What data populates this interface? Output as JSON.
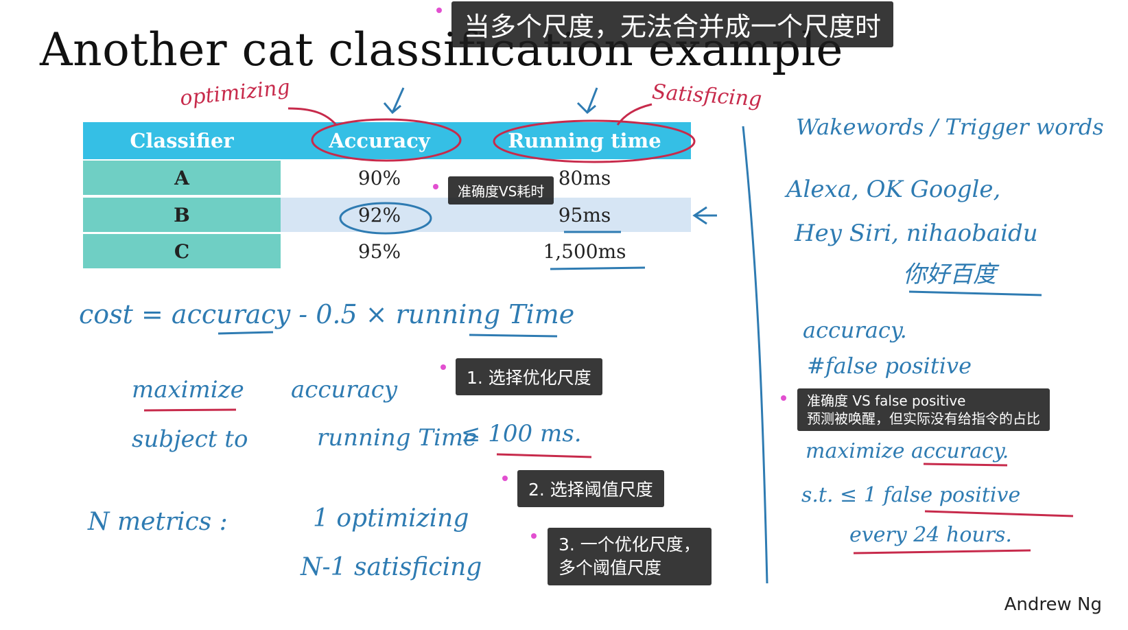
{
  "slide": {
    "title": "Another cat classification example",
    "credit": "Andrew Ng"
  },
  "table": {
    "headers": [
      "Classifier",
      "Accuracy",
      "Running time"
    ],
    "rows": [
      {
        "name": "A",
        "accuracy": "90%",
        "running_time": "80ms"
      },
      {
        "name": "B",
        "accuracy": "92%",
        "running_time": "95ms"
      },
      {
        "name": "C",
        "accuracy": "95%",
        "running_time": "1,500ms"
      }
    ]
  },
  "annotations": {
    "optimizing_label": "optimizing",
    "satisficing_label": "Satisficing",
    "cost_formula": "cost = accuracy - 0.5 × running Time",
    "maximize": "maximize",
    "maximize_target": "accuracy",
    "subject_to": "subject to",
    "constraint": "running Time",
    "constraint_bound": "≤ 100 ms.",
    "n_metrics": "N metrics :",
    "one_optimizing": "1 optimizing",
    "n_minus_one": "N-1 satisficing"
  },
  "right_notes": {
    "wakewords": "Wakewords / Trigger words",
    "examples_1": "Alexa, OK Google,",
    "examples_2": "Hey Siri, nihaobaidu",
    "examples_3": "你好百度",
    "accuracy": "accuracy.",
    "false_positive": "#false positive",
    "maximize_accuracy": "maximize accuracy.",
    "st": "s.t. ≤ 1 false positive",
    "every": "every 24 hours."
  },
  "subtitles": {
    "top": "当多个尺度，无法合并成一个尺度时",
    "table_note": "准确度VS耗时",
    "step1": "1. 选择优化尺度",
    "step2": "2. 选择阈值尺度",
    "step3_line1": "3. 一个优化尺度，",
    "step3_line2": "多个阈值尺度",
    "fp_line1": "准确度 VS false positive",
    "fp_line2": "预测被唤醒，但实际没有给指令的占比"
  }
}
